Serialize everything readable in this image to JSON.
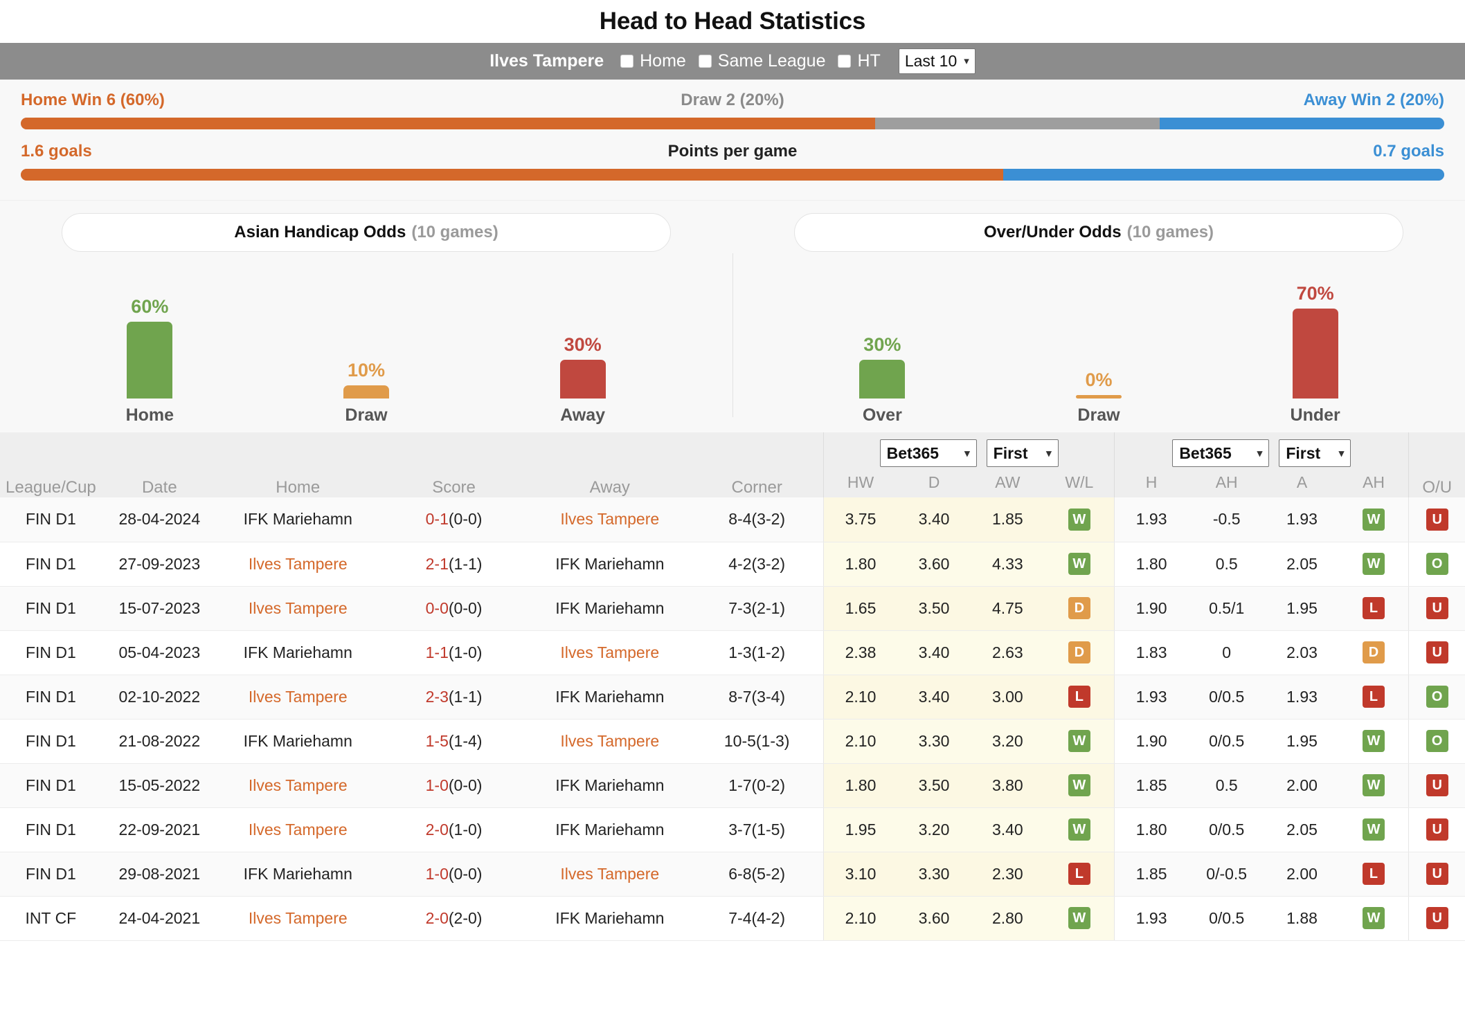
{
  "header": {
    "title": "Head to Head Statistics"
  },
  "filter": {
    "team": "Ilves Tampere",
    "checkboxes": [
      {
        "label": "Home",
        "checked": false
      },
      {
        "label": "Same League",
        "checked": false
      },
      {
        "label": "HT",
        "checked": false
      }
    ],
    "range_select": {
      "value": "Last 10"
    }
  },
  "summary": {
    "result_row": {
      "left": "Home Win 6 (60%)",
      "mid": "Draw 2 (20%)",
      "right": "Away Win 2 (20%)",
      "home_pct": 60,
      "draw_pct": 20,
      "away_pct": 20
    },
    "goals_row": {
      "left": "1.6 goals",
      "mid": "Points per game",
      "right": "0.7 goals",
      "home_share": 69,
      "away_share": 31
    }
  },
  "panels": [
    {
      "title": "Asian Handicap Odds",
      "games": "(10 games)",
      "bars": [
        {
          "name": "Home",
          "pct": "60%",
          "value": 60,
          "color": "#70a44e"
        },
        {
          "name": "Draw",
          "pct": "10%",
          "value": 10,
          "color": "#e09b4a"
        },
        {
          "name": "Away",
          "pct": "30%",
          "value": 30,
          "color": "#c0483f"
        }
      ]
    },
    {
      "title": "Over/Under Odds",
      "games": "(10 games)",
      "bars": [
        {
          "name": "Over",
          "pct": "30%",
          "value": 30,
          "color": "#70a44e"
        },
        {
          "name": "Draw",
          "pct": "0%",
          "value": 0,
          "color": "#e09b4a"
        },
        {
          "name": "Under",
          "pct": "70%",
          "value": 70,
          "color": "#c0483f"
        }
      ]
    }
  ],
  "chart_data": [
    {
      "type": "bar",
      "title": "Asian Handicap Odds (10 games)",
      "categories": [
        "Home",
        "Draw",
        "Away"
      ],
      "values": [
        60,
        10,
        30
      ],
      "ylabel": "%",
      "xlabel": "",
      "ylim": [
        0,
        100
      ]
    },
    {
      "type": "bar",
      "title": "Over/Under Odds (10 games)",
      "categories": [
        "Over",
        "Draw",
        "Under"
      ],
      "values": [
        30,
        0,
        70
      ],
      "ylabel": "%",
      "xlabel": "",
      "ylim": [
        0,
        100
      ]
    },
    {
      "type": "bar",
      "title": "Head to Head result distribution",
      "categories": [
        "Home Win",
        "Draw",
        "Away Win"
      ],
      "values": [
        60,
        20,
        20
      ],
      "counts": [
        6,
        2,
        2
      ],
      "ylabel": "%",
      "xlabel": "",
      "ylim": [
        0,
        100
      ]
    }
  ],
  "table": {
    "left_headers": [
      "League/Cup",
      "Date",
      "Home",
      "Score",
      "Away",
      "Corner"
    ],
    "odds_group_1": {
      "bookmaker": "Bet365",
      "phase": "First"
    },
    "odds_group_2": {
      "bookmaker": "Bet365",
      "phase": "First"
    },
    "sub_headers_1": [
      "HW",
      "D",
      "AW",
      "W/L"
    ],
    "sub_headers_2": [
      "H",
      "AH",
      "A",
      "AH"
    ],
    "sub_header_ou": "O/U",
    "rows": [
      {
        "league": "FIN D1",
        "date": "28-04-2024",
        "home": "IFK Mariehamn",
        "home_highlight": false,
        "score_main": "0-1",
        "score_ht": "(0-0)",
        "away": "Ilves Tampere",
        "away_highlight": true,
        "corner": "8-4(3-2)",
        "hw": "3.75",
        "d": "3.40",
        "aw": "1.85",
        "wl": "W",
        "h": "1.93",
        "ah1": "-0.5",
        "a": "1.93",
        "ah2": "W",
        "ou": "U"
      },
      {
        "league": "FIN D1",
        "date": "27-09-2023",
        "home": "Ilves Tampere",
        "home_highlight": true,
        "score_main": "2-1",
        "score_ht": "(1-1)",
        "away": "IFK Mariehamn",
        "away_highlight": false,
        "corner": "4-2(3-2)",
        "hw": "1.80",
        "d": "3.60",
        "aw": "4.33",
        "wl": "W",
        "h": "1.80",
        "ah1": "0.5",
        "a": "2.05",
        "ah2": "W",
        "ou": "O"
      },
      {
        "league": "FIN D1",
        "date": "15-07-2023",
        "home": "Ilves Tampere",
        "home_highlight": true,
        "score_main": "0-0",
        "score_ht": "(0-0)",
        "away": "IFK Mariehamn",
        "away_highlight": false,
        "corner": "7-3(2-1)",
        "hw": "1.65",
        "d": "3.50",
        "aw": "4.75",
        "wl": "D",
        "h": "1.90",
        "ah1": "0.5/1",
        "a": "1.95",
        "ah2": "L",
        "ou": "U"
      },
      {
        "league": "FIN D1",
        "date": "05-04-2023",
        "home": "IFK Mariehamn",
        "home_highlight": false,
        "score_main": "1-1",
        "score_ht": "(1-0)",
        "away": "Ilves Tampere",
        "away_highlight": true,
        "corner": "1-3(1-2)",
        "hw": "2.38",
        "d": "3.40",
        "aw": "2.63",
        "wl": "D",
        "h": "1.83",
        "ah1": "0",
        "a": "2.03",
        "ah2": "D",
        "ou": "U"
      },
      {
        "league": "FIN D1",
        "date": "02-10-2022",
        "home": "Ilves Tampere",
        "home_highlight": true,
        "score_main": "2-3",
        "score_ht": "(1-1)",
        "away": "IFK Mariehamn",
        "away_highlight": false,
        "corner": "8-7(3-4)",
        "hw": "2.10",
        "d": "3.40",
        "aw": "3.00",
        "wl": "L",
        "h": "1.93",
        "ah1": "0/0.5",
        "a": "1.93",
        "ah2": "L",
        "ou": "O"
      },
      {
        "league": "FIN D1",
        "date": "21-08-2022",
        "home": "IFK Mariehamn",
        "home_highlight": false,
        "score_main": "1-5",
        "score_ht": "(1-4)",
        "away": "Ilves Tampere",
        "away_highlight": true,
        "corner": "10-5(1-3)",
        "hw": "2.10",
        "d": "3.30",
        "aw": "3.20",
        "wl": "W",
        "h": "1.90",
        "ah1": "0/0.5",
        "a": "1.95",
        "ah2": "W",
        "ou": "O"
      },
      {
        "league": "FIN D1",
        "date": "15-05-2022",
        "home": "Ilves Tampere",
        "home_highlight": true,
        "score_main": "1-0",
        "score_ht": "(0-0)",
        "away": "IFK Mariehamn",
        "away_highlight": false,
        "corner": "1-7(0-2)",
        "hw": "1.80",
        "d": "3.50",
        "aw": "3.80",
        "wl": "W",
        "h": "1.85",
        "ah1": "0.5",
        "a": "2.00",
        "ah2": "W",
        "ou": "U"
      },
      {
        "league": "FIN D1",
        "date": "22-09-2021",
        "home": "Ilves Tampere",
        "home_highlight": true,
        "score_main": "2-0",
        "score_ht": "(1-0)",
        "away": "IFK Mariehamn",
        "away_highlight": false,
        "corner": "3-7(1-5)",
        "hw": "1.95",
        "d": "3.20",
        "aw": "3.40",
        "wl": "W",
        "h": "1.80",
        "ah1": "0/0.5",
        "a": "2.05",
        "ah2": "W",
        "ou": "U"
      },
      {
        "league": "FIN D1",
        "date": "29-08-2021",
        "home": "IFK Mariehamn",
        "home_highlight": false,
        "score_main": "1-0",
        "score_ht": "(0-0)",
        "away": "Ilves Tampere",
        "away_highlight": true,
        "corner": "6-8(5-2)",
        "hw": "3.10",
        "d": "3.30",
        "aw": "2.30",
        "wl": "L",
        "h": "1.85",
        "ah1": "0/-0.5",
        "a": "2.00",
        "ah2": "L",
        "ou": "U"
      },
      {
        "league": "INT CF",
        "date": "24-04-2021",
        "home": "Ilves Tampere",
        "home_highlight": true,
        "score_main": "2-0",
        "score_ht": "(2-0)",
        "away": "IFK Mariehamn",
        "away_highlight": false,
        "corner": "7-4(4-2)",
        "hw": "2.10",
        "d": "3.60",
        "aw": "2.80",
        "wl": "W",
        "h": "1.93",
        "ah1": "0/0.5",
        "a": "1.88",
        "ah2": "W",
        "ou": "U"
      }
    ]
  }
}
